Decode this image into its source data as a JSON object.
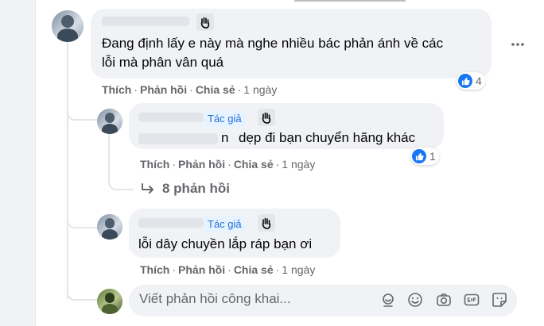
{
  "comment": {
    "text_line1": "Đang định lấy e này mà nghe nhiều bác phản ánh về các",
    "text_line2": "lỗi mà phân vân quá",
    "actions": {
      "like": "Thích",
      "reply": "Phản hồi",
      "share": "Chia sẻ",
      "time": "1 ngày",
      "sep": "·"
    },
    "reaction_count": "4"
  },
  "reply1": {
    "badge": "Tác giả",
    "text": "dẹp đi bạn chuyển hãng khác",
    "text_fragment": "n",
    "actions": {
      "like": "Thích",
      "reply": "Phản hồi",
      "share": "Chia sẻ",
      "time": "1 ngày",
      "sep": "·"
    },
    "reaction_count": "1"
  },
  "more_replies": {
    "label": "8 phản hồi"
  },
  "reply2": {
    "badge": "Tác giả",
    "text": "lỗi dây chuyền lắp ráp bạn ơi",
    "actions": {
      "like": "Thích",
      "reply": "Phản hồi",
      "share": "Chia sẻ",
      "time": "1 ngày",
      "sep": "·"
    }
  },
  "reply_box": {
    "placeholder": "Viết phản hồi công khai..."
  },
  "colors": {
    "link": "#216fdb",
    "like": "#1877f2",
    "muted": "#65676b"
  }
}
